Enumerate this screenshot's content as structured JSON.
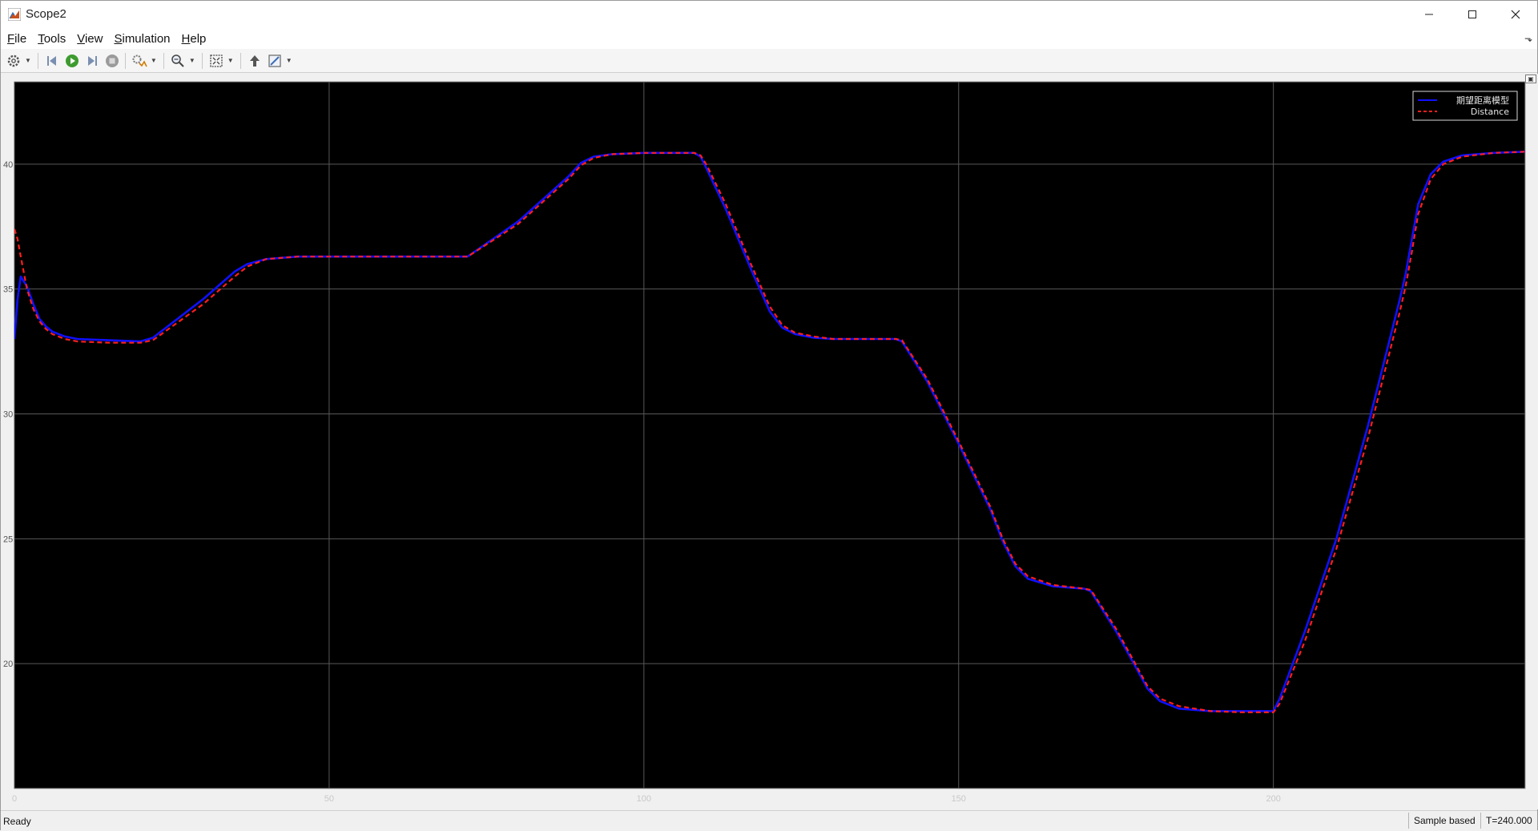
{
  "window": {
    "title": "Scope2",
    "controls": {
      "minimize": "—",
      "maximize": "☐",
      "close": "✕"
    }
  },
  "menu": {
    "items": [
      {
        "key": "F",
        "rest": "ile"
      },
      {
        "key": "T",
        "rest": "ools"
      },
      {
        "key": "V",
        "rest": "iew"
      },
      {
        "key": "S",
        "rest": "imulation"
      },
      {
        "key": "H",
        "rest": "elp"
      }
    ]
  },
  "toolbar": {
    "icons": [
      "gear-icon",
      "step-back-icon",
      "run-icon",
      "step-forward-icon",
      "stop-icon",
      "signal-settings-icon",
      "zoom-icon",
      "autoscale-icon",
      "highlight-block-icon",
      "style-icon"
    ]
  },
  "status": {
    "ready": "Ready",
    "mode": "Sample based",
    "time": "T=240.000"
  },
  "colors": {
    "plot_bg": "#000000",
    "grid": "#585858",
    "series1": "#1010ff",
    "series2": "#ff1e1e",
    "tick": "#c8c8c8"
  },
  "chart_data": {
    "type": "line",
    "title": "",
    "xlabel": "",
    "ylabel": "",
    "xlim": [
      0,
      240
    ],
    "ylim": [
      15,
      43.3
    ],
    "xticks": [
      0,
      50,
      100,
      150,
      200
    ],
    "xtick_labels": [
      "0",
      "50",
      "100",
      "150",
      "200"
    ],
    "yticks": [
      20,
      25,
      30,
      35,
      40
    ],
    "ytick_labels": [
      "20",
      "25",
      "30",
      "35",
      "40"
    ],
    "grid": true,
    "legend_position": "top-right",
    "series": [
      {
        "name": "期望距离模型",
        "style": "solid",
        "x": [
          0,
          0.5,
          1,
          2,
          3,
          4,
          5,
          6,
          8,
          10,
          15,
          20,
          22,
          30,
          35,
          37,
          40,
          45,
          50,
          60,
          70,
          72,
          80,
          88,
          90,
          92,
          95,
          100,
          105,
          108,
          109,
          110,
          113,
          117,
          120,
          122,
          124,
          127,
          130,
          135,
          140,
          141,
          145,
          150,
          155,
          157,
          159,
          161,
          165,
          170,
          171,
          175,
          180,
          182,
          185,
          190,
          195,
          200,
          201,
          205,
          210,
          215,
          220,
          221,
          222,
          223,
          225,
          227,
          230,
          235,
          240
        ],
        "y": [
          33.0,
          34.6,
          35.5,
          35.1,
          34.4,
          33.8,
          33.5,
          33.3,
          33.1,
          33.0,
          32.95,
          32.9,
          33.05,
          34.6,
          35.7,
          36.0,
          36.2,
          36.3,
          36.3,
          36.3,
          36.3,
          36.3,
          37.7,
          39.5,
          40.05,
          40.3,
          40.4,
          40.45,
          40.45,
          40.45,
          40.3,
          39.8,
          38.2,
          35.8,
          34.1,
          33.45,
          33.2,
          33.05,
          33.0,
          33.0,
          33.0,
          32.9,
          31.3,
          28.8,
          26.2,
          24.9,
          23.9,
          23.4,
          23.1,
          23.0,
          22.9,
          21.3,
          19.0,
          18.5,
          18.2,
          18.1,
          18.1,
          18.1,
          18.6,
          21.3,
          25.0,
          29.5,
          34.5,
          35.6,
          37.0,
          38.4,
          39.6,
          40.1,
          40.35,
          40.45,
          40.5
        ]
      },
      {
        "name": "Distance",
        "style": "dashed",
        "x": [
          0,
          0.5,
          1,
          2,
          3,
          4,
          5,
          6,
          8,
          10,
          15,
          20,
          22,
          30,
          35,
          37,
          40,
          45,
          50,
          60,
          70,
          72,
          80,
          88,
          90,
          92,
          95,
          100,
          105,
          108,
          109,
          110,
          113,
          117,
          120,
          122,
          124,
          127,
          130,
          135,
          140,
          141,
          145,
          150,
          155,
          157,
          159,
          161,
          165,
          170,
          171,
          175,
          180,
          182,
          185,
          190,
          195,
          200,
          201,
          205,
          210,
          215,
          220,
          221,
          222,
          223,
          225,
          227,
          230,
          235,
          240
        ],
        "y": [
          37.4,
          37.0,
          36.3,
          35.0,
          34.2,
          33.7,
          33.4,
          33.2,
          33.0,
          32.9,
          32.85,
          32.85,
          32.95,
          34.4,
          35.5,
          35.9,
          36.2,
          36.3,
          36.3,
          36.3,
          36.3,
          36.3,
          37.6,
          39.4,
          39.95,
          40.25,
          40.4,
          40.45,
          40.45,
          40.45,
          40.35,
          39.95,
          38.4,
          36.0,
          34.3,
          33.55,
          33.25,
          33.1,
          33.0,
          33.0,
          33.0,
          32.95,
          31.4,
          28.9,
          26.3,
          25.0,
          24.0,
          23.5,
          23.15,
          23.0,
          22.95,
          21.4,
          19.1,
          18.6,
          18.3,
          18.1,
          18.05,
          18.05,
          18.4,
          20.9,
          24.6,
          29.0,
          34.0,
          35.1,
          36.5,
          38.0,
          39.4,
          40.0,
          40.3,
          40.45,
          40.5
        ]
      }
    ]
  }
}
